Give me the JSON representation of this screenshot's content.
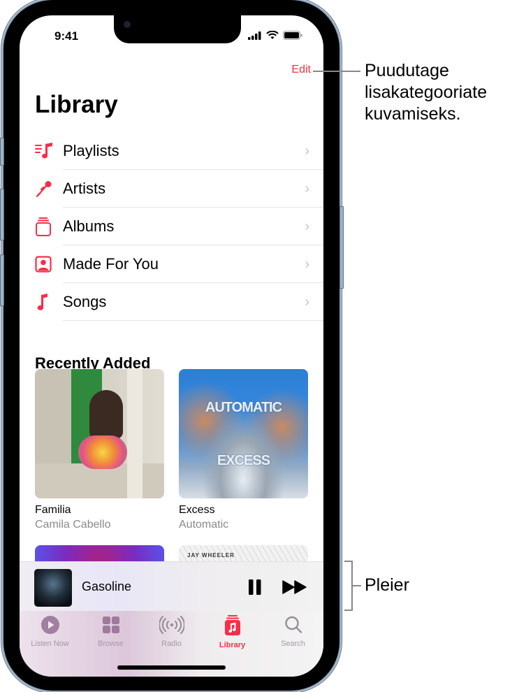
{
  "status_bar": {
    "time": "9:41",
    "icons": [
      "cellular-signal-icon",
      "wifi-icon",
      "battery-icon"
    ]
  },
  "nav": {
    "edit_label": "Edit"
  },
  "page_title": "Library",
  "library_items": [
    {
      "label": "Playlists",
      "icon": "playlists-icon"
    },
    {
      "label": "Artists",
      "icon": "microphone-icon"
    },
    {
      "label": "Albums",
      "icon": "albums-icon"
    },
    {
      "label": "Made For You",
      "icon": "person-square-icon"
    },
    {
      "label": "Songs",
      "icon": "music-note-icon"
    }
  ],
  "recently_added": {
    "title": "Recently Added",
    "albums": [
      {
        "title": "Familia",
        "artist": "Camila Cabello"
      },
      {
        "title": "Excess",
        "artist": "Automatic",
        "art_text_top": "AUTOMATIC",
        "art_text_bottom": "EXCESS"
      },
      {
        "title": "",
        "artist": ""
      },
      {
        "title": "",
        "artist": "",
        "art_text_top": "JAY WHEELER"
      }
    ]
  },
  "mini_player": {
    "track": "Gasoline",
    "controls": [
      "pause",
      "skip-forward"
    ]
  },
  "tab_bar": {
    "tabs": [
      {
        "label": "Listen Now",
        "icon": "play-circle-icon"
      },
      {
        "label": "Browse",
        "icon": "grid-icon"
      },
      {
        "label": "Radio",
        "icon": "radio-waves-icon"
      },
      {
        "label": "Library",
        "icon": "library-icon",
        "active": true
      },
      {
        "label": "Search",
        "icon": "search-icon"
      }
    ]
  },
  "callouts": {
    "edit_callout": [
      "Puudutage",
      "lisakategooriate",
      "kuvamiseks."
    ],
    "player_callout": "Pleier"
  },
  "colors": {
    "accent": "#fa2d48",
    "tab_inactive": "#a399a4",
    "chevron": "#c4c4c7",
    "secondary_text": "#8a8a8e"
  }
}
